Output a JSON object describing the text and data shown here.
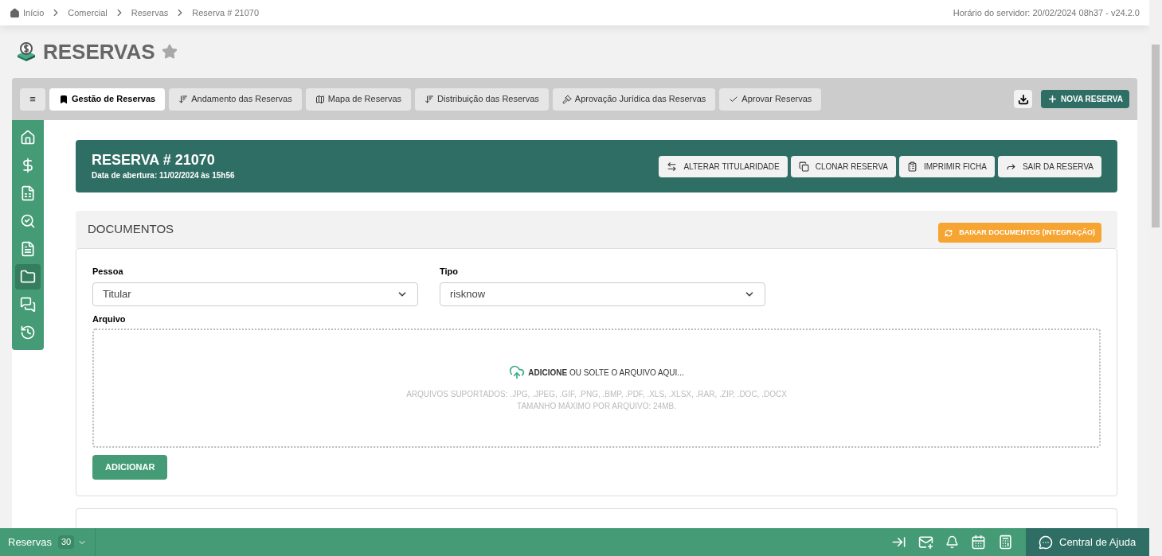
{
  "breadcrumb": [
    {
      "label": "Início",
      "kind": "home"
    },
    {
      "label": "Comercial",
      "kind": "link"
    },
    {
      "label": "Reservas",
      "kind": "link"
    },
    {
      "label": "Reserva # 21070",
      "kind": "current"
    }
  ],
  "server_time": "Horário do servidor: 20/02/2024 08h37 - v24.2.0",
  "page_title": "RESERVAS",
  "favorite": false,
  "menu_button": "≡",
  "tabs": [
    {
      "label": "Gestão de Reservas",
      "selected": true
    },
    {
      "label": "Andamento das Reservas",
      "selected": false
    },
    {
      "label": "Mapa de Reservas",
      "selected": false
    },
    {
      "label": "Distribuição das Reservas",
      "selected": false
    },
    {
      "label": "Aprovação Jurídica das Reservas",
      "selected": false
    },
    {
      "label": "Aprovar Reservas",
      "selected": false
    }
  ],
  "new_button": "NOVA RESERVA",
  "sidebar": {
    "items": [
      {
        "selected": false
      },
      {
        "selected": false
      },
      {
        "selected": false
      },
      {
        "selected": false
      },
      {
        "selected": false
      },
      {
        "selected": true
      },
      {
        "selected": false
      },
      {
        "selected": false
      }
    ]
  },
  "header": {
    "title": "RESERVA # 21070",
    "subtitle": "Data de abertura: 11/02/2024 às 15h56",
    "actions": [
      "ALTERAR TITULARIDADE",
      "CLONAR RESERVA",
      "IMPRIMIR FICHA",
      "SAIR DA RESERVA"
    ]
  },
  "documents": {
    "title": "DOCUMENTOS",
    "download_button": "BAIXAR DOCUMENTOS (INTEGRAÇÃO)",
    "fields": [
      {
        "label": "Pessoa",
        "value": "Titular"
      },
      {
        "label": "Tipo",
        "value": "risknow"
      }
    ],
    "file_label": "Arquivo",
    "dropzone": {
      "action": "ADICIONE",
      "text": "OU SOLTE O ARQUIVO AQUI...",
      "supported": "ARQUIVOS SUPORTADOS: .JPG, .JPEG, .GIF, .PNG, .BMP, .PDF, .XLS, .XLSX, .RAR, .ZIP, .DOC, .DOCX",
      "max_size": "TAMANHO MÁXIMO POR ARQUIVO: 24MB."
    },
    "add_button": "ADICIONAR"
  },
  "bottom_bar": {
    "module": "Reservas",
    "count": "30",
    "help": "Central de Ajuda"
  }
}
